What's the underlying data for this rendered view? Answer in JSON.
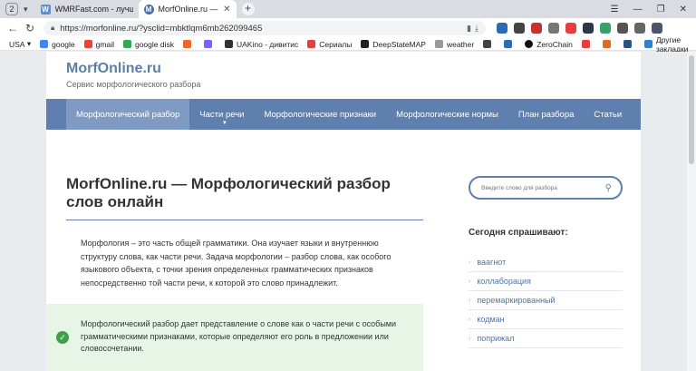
{
  "tabs": {
    "count": "2",
    "items": [
      {
        "favicon": "W",
        "title": "WMRFast.com - лучшие м"
      },
      {
        "favicon": "M",
        "title": "MorfOnline.ru — Морф"
      }
    ]
  },
  "addressbar": {
    "url": "https://morfonline.ru/?ysclid=mbktlqm6mb262099465"
  },
  "bookmarks": {
    "items": [
      "USA",
      "google",
      "gmail",
      "google disk",
      "",
      "",
      "UAKino - дивитис",
      "Сериалы",
      "DeepStateMAP",
      "weather",
      "",
      "",
      "ZeroChain",
      "",
      "",
      "",
      ""
    ],
    "other": "Другие закладки"
  },
  "site": {
    "logo": "MorfOnline.ru",
    "tagline": "Сервис морфологического разбора",
    "menu": [
      "Морфологический разбор",
      "Части речи",
      "Морфологические признаки",
      "Морфологические нормы",
      "План разбора",
      "Статьи"
    ],
    "heading": "MorfOnline.ru — Морфологический разбор слов онлайн",
    "intro": "Морфология – это часть общей грамматики. Она изучает языки и внутреннюю структуру слова, как части речи. Задача морфологии – разбор слова, как особого языкового объекта, с точки зрения определенных грамматических признаков непосредственно той части речи, к которой это слово принадлежит.",
    "notice": "Морфологический разбор дает представление о слове как о части речи с особыми грамматическими признаками, которые определяют его роль в предложении или словосочетании.",
    "search_placeholder": "Введите слово для разбора",
    "sidebar_title": "Сегодня спрашивают:",
    "sidebar_items": [
      "ваагнот",
      "коллаборация",
      "перемаркированный",
      "кодман",
      "поприжал"
    ]
  },
  "colors": {
    "menu_bg": "#5f7fae",
    "menu_active": "#7f9bc4",
    "link": "#4f75a8",
    "notice_bg": "#e6f5e6",
    "check": "#3fa04a"
  }
}
